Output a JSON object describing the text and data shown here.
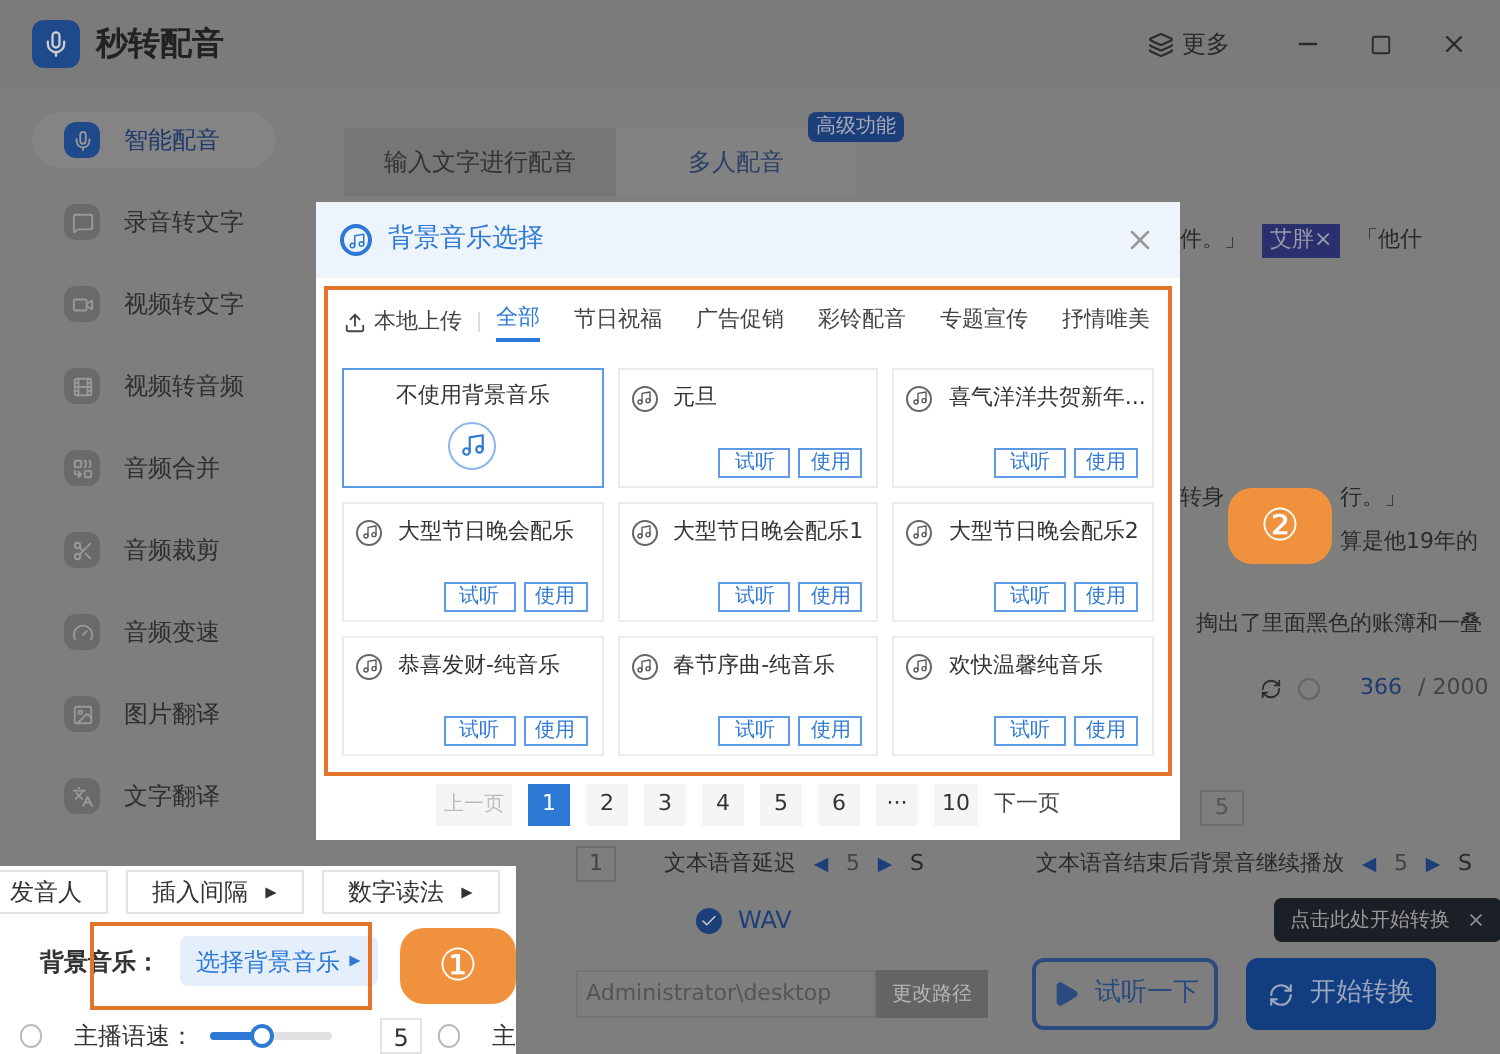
{
  "app": {
    "title": "秒转配音",
    "more": "更多"
  },
  "sidebar": {
    "items": [
      {
        "label": "智能配音",
        "selected": true
      },
      {
        "label": "录音转文字",
        "selected": false
      },
      {
        "label": "视频转文字",
        "selected": false
      },
      {
        "label": "视频转音频",
        "selected": false
      },
      {
        "label": "音频合并",
        "selected": false
      },
      {
        "label": "音频裁剪",
        "selected": false
      },
      {
        "label": "音频变速",
        "selected": false
      },
      {
        "label": "图片翻译",
        "selected": false
      },
      {
        "label": "文字翻译",
        "selected": false
      }
    ]
  },
  "tabs": [
    {
      "label": "输入文字进行配音",
      "selected": false
    },
    {
      "label": "多人配音",
      "selected": true
    }
  ],
  "tab_badge": "高级功能",
  "editor": {
    "line_1": "件。」",
    "speaker_tag": "艾胖×",
    "line_1_end": "「他什",
    "line_2_start": "转身",
    "line_2_end": "行。」",
    "line_3": "算是他19年的",
    "line_4": "掏出了里面黑色的账簿和一叠",
    "char_count": "366",
    "char_limit": "/ 2000"
  },
  "settings": {
    "spinner_value": "1",
    "delay_label": "文本语音延迟",
    "delay_value": "5",
    "delay_unit": "S",
    "tail_label": "文本语音结束后背景音继续播放",
    "tail_value": "5",
    "tail_unit": "S",
    "format": {
      "label": "WAV",
      "checked": true
    },
    "right_value": "5",
    "path": "Administrator\\desktop",
    "change_path": "更改路径",
    "preview": "试听一下",
    "start": "开始转换",
    "tooltip": "点击此处开始转换"
  },
  "highlight": {
    "buttons": [
      "发音人",
      "插入间隔",
      "数字读法"
    ],
    "bg_music_label": "背景音乐：",
    "bg_music_button": "选择背景音乐",
    "speed_radio": {
      "checked": false
    },
    "speed_label": "主播语速：",
    "speed": {
      "level": 0.43
    },
    "speed_value": "5",
    "next_radio": {
      "checked": false
    },
    "next_label": "主"
  },
  "callouts": [
    "①",
    "②"
  ],
  "modal": {
    "title": "背景音乐选择",
    "upload": "本地上传",
    "categories": [
      {
        "label": "全部",
        "selected": true
      },
      {
        "label": "节日祝福",
        "selected": false
      },
      {
        "label": "广告促销",
        "selected": false
      },
      {
        "label": "彩铃配音",
        "selected": false
      },
      {
        "label": "专题宣传",
        "selected": false
      },
      {
        "label": "抒情唯美",
        "selected": false
      }
    ],
    "tracks": [
      {
        "kind": "none",
        "title": "不使用背景音乐",
        "selected": true
      },
      {
        "kind": "track",
        "title": "元旦",
        "selected": false,
        "listen": "试听",
        "use": "使用"
      },
      {
        "kind": "track",
        "title": "喜气洋洋共贺新年...",
        "selected": false,
        "listen": "试听",
        "use": "使用"
      },
      {
        "kind": "track",
        "title": "大型节日晚会配乐",
        "selected": false,
        "listen": "试听",
        "use": "使用"
      },
      {
        "kind": "track",
        "title": "大型节日晚会配乐1",
        "selected": false,
        "listen": "试听",
        "use": "使用"
      },
      {
        "kind": "track",
        "title": "大型节日晚会配乐2",
        "selected": false,
        "listen": "试听",
        "use": "使用"
      },
      {
        "kind": "track",
        "title": "恭喜发财-纯音乐",
        "selected": false,
        "listen": "试听",
        "use": "使用"
      },
      {
        "kind": "track",
        "title": "春节序曲-纯音乐",
        "selected": false,
        "listen": "试听",
        "use": "使用"
      },
      {
        "kind": "track",
        "title": "欢快温馨纯音乐",
        "selected": false,
        "listen": "试听",
        "use": "使用"
      }
    ],
    "pagination": {
      "prev": "上一页",
      "pages": [
        {
          "label": "1",
          "selected": true
        },
        {
          "label": "2",
          "selected": false
        },
        {
          "label": "3",
          "selected": false
        },
        {
          "label": "4",
          "selected": false
        },
        {
          "label": "5",
          "selected": false
        },
        {
          "label": "6",
          "selected": false
        },
        {
          "label": "···",
          "selected": false
        },
        {
          "label": "10",
          "selected": false
        }
      ],
      "next": "下一页"
    }
  }
}
